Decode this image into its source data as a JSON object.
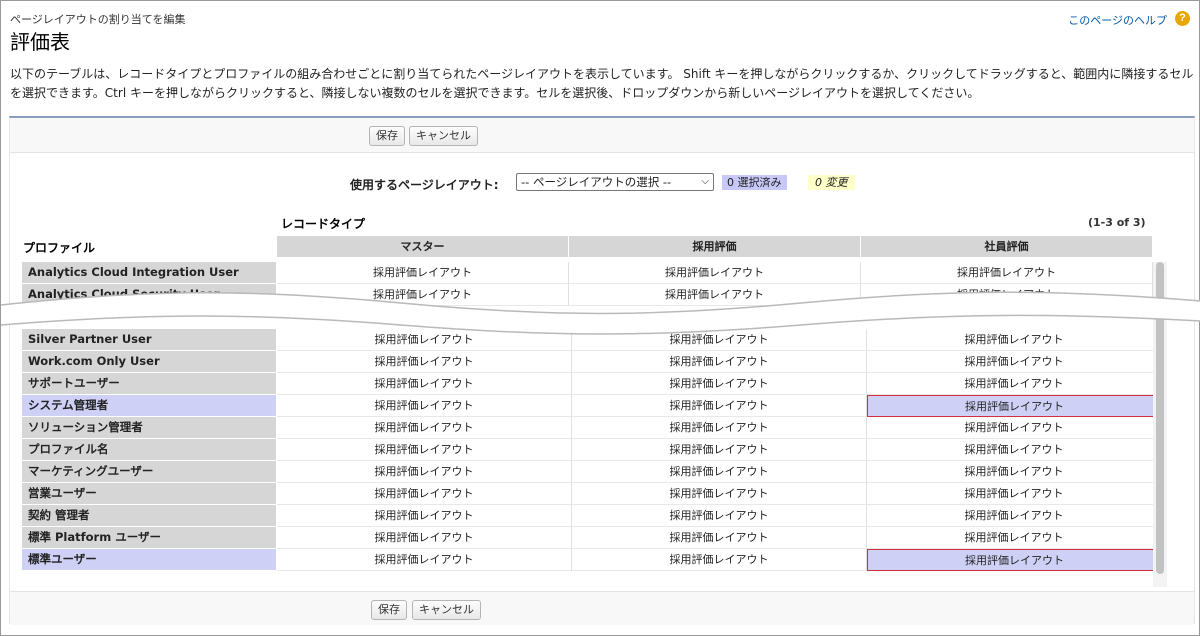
{
  "header": {
    "breadcrumb": "ページレイアウトの割り当てを編集",
    "title": "評価表",
    "help_link": "このページのヘルプ",
    "help_icon": "question-icon"
  },
  "description": "以下のテーブルは、レコードタイプとプロファイルの組み合わせごとに割り当てられたページレイアウトを表示しています。 Shift キーを押しながらクリックするか、クリックしてドラッグすると、範囲内に隣接するセルを選択できます。Ctrl キーを押しながらクリックすると、隣接しない複数のセルを選択できます。セルを選択後、ドロップダウンから新しいページレイアウトを選択してください。",
  "buttons": {
    "save": "保存",
    "cancel": "キャンセル"
  },
  "selector": {
    "label": "使用するページレイアウト:",
    "value": "-- ページレイアウトの選択 --",
    "selected_count": "0 選択済み",
    "changes_count": "0 変更"
  },
  "table": {
    "record_type_label": "レコードタイプ",
    "profile_header": "プロファイル",
    "page_count": "(1-3 of 3)",
    "columns": [
      "マスター",
      "採用評価",
      "社員評価"
    ],
    "rows_top": [
      {
        "profile": "Analytics Cloud Integration User",
        "cells": [
          "採用評価レイアウト",
          "採用評価レイアウト",
          "採用評価レイアウト"
        ]
      },
      {
        "profile": "Analytics Cloud Security User",
        "cells": [
          "採用評価レイアウト",
          "採用評価レイアウト",
          "採用評価レイアウト"
        ]
      }
    ],
    "rows_bottom": [
      {
        "profile": "Silver Partner User",
        "cells": [
          "採用評価レイアウト",
          "採用評価レイアウト",
          "採用評価レイアウト"
        ]
      },
      {
        "profile": "Work.com Only User",
        "cells": [
          "採用評価レイアウト",
          "採用評価レイアウト",
          "採用評価レイアウト"
        ]
      },
      {
        "profile": "サポートユーザー",
        "cells": [
          "採用評価レイアウト",
          "採用評価レイアウト",
          "採用評価レイアウト"
        ]
      },
      {
        "profile": "システム管理者",
        "selected": true,
        "picked_col": 2,
        "cells": [
          "採用評価レイアウト",
          "採用評価レイアウト",
          "採用評価レイアウト"
        ]
      },
      {
        "profile": "ソリューション管理者",
        "cells": [
          "採用評価レイアウト",
          "採用評価レイアウト",
          "採用評価レイアウト"
        ]
      },
      {
        "profile": "プロファイル名",
        "cells": [
          "採用評価レイアウト",
          "採用評価レイアウト",
          "採用評価レイアウト"
        ]
      },
      {
        "profile": "マーケティングユーザー",
        "cells": [
          "採用評価レイアウト",
          "採用評価レイアウト",
          "採用評価レイアウト"
        ]
      },
      {
        "profile": "営業ユーザー",
        "cells": [
          "採用評価レイアウト",
          "採用評価レイアウト",
          "採用評価レイアウト"
        ]
      },
      {
        "profile": "契約 管理者",
        "cells": [
          "採用評価レイアウト",
          "採用評価レイアウト",
          "採用評価レイアウト"
        ]
      },
      {
        "profile": "標準 Platform ユーザー",
        "cells": [
          "採用評価レイアウト",
          "採用評価レイアウト",
          "採用評価レイアウト"
        ]
      },
      {
        "profile": "標準ユーザー",
        "selected": true,
        "picked_col": 2,
        "cells": [
          "採用評価レイアウト",
          "採用評価レイアウト",
          "採用評価レイアウト"
        ]
      }
    ]
  },
  "colors": {
    "selected_bg": "#cfd0f5",
    "picked_border": "#d0303a",
    "header_bg": "#d6d6d6",
    "link": "#015ba7"
  }
}
